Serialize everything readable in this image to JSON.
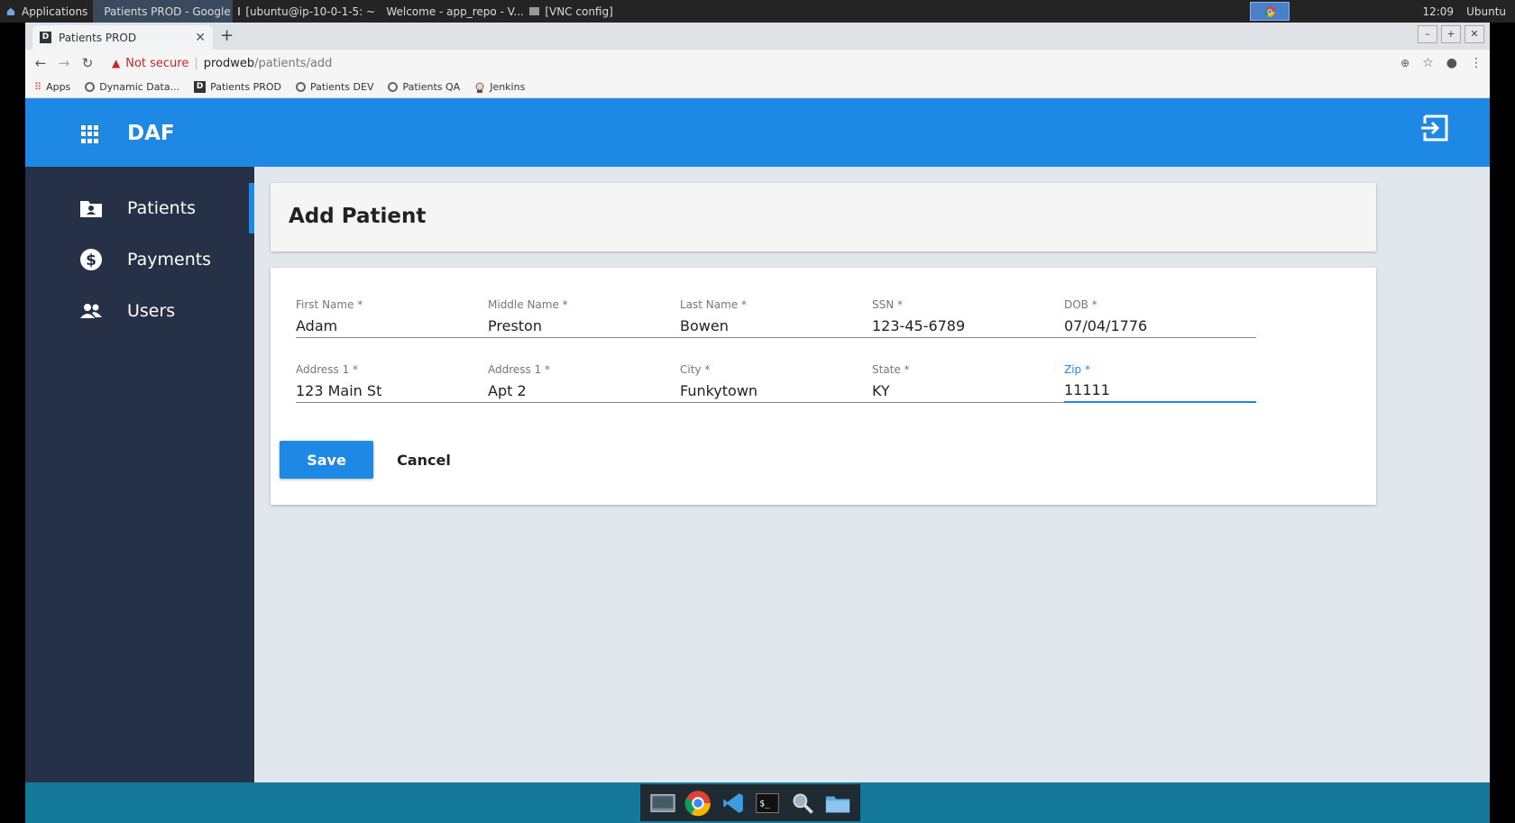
{
  "os_panel": {
    "apps_label": "Applications",
    "tasks": [
      {
        "label": "Patients PROD - Google ..."
      },
      {
        "label": "[ubuntu@ip-10-0-1-5: ~]"
      },
      {
        "label": "Welcome - app_repo - V..."
      },
      {
        "label": "[VNC config]"
      }
    ],
    "clock": "12:09",
    "user": "Ubuntu"
  },
  "browser": {
    "tab_title": "Patients PROD",
    "tab_favicon": "D",
    "security_label": "Not secure",
    "url_host": "prodweb",
    "url_path": "/patients/add",
    "bookmarks": [
      {
        "label": "Apps",
        "icon": "apps-grid-icon"
      },
      {
        "label": "Dynamic Data...",
        "icon": "globe-icon"
      },
      {
        "label": "Patients PROD",
        "icon": "d-favicon"
      },
      {
        "label": "Patients DEV",
        "icon": "globe-icon"
      },
      {
        "label": "Patients QA",
        "icon": "globe-icon"
      },
      {
        "label": "Jenkins",
        "icon": "jenkins-icon"
      }
    ]
  },
  "app": {
    "title": "DAF",
    "accent": "#1e88e5",
    "sidebar_bg": "#263046"
  },
  "sidebar": {
    "items": [
      {
        "label": "Patients",
        "icon": "patient-folder-icon",
        "active": true
      },
      {
        "label": "Payments",
        "icon": "dollar-circle-icon",
        "active": false
      },
      {
        "label": "Users",
        "icon": "users-icon",
        "active": false
      }
    ]
  },
  "page": {
    "title": "Add Patient"
  },
  "form": {
    "fields": [
      {
        "label": "First Name *",
        "value": "Adam"
      },
      {
        "label": "Middle Name *",
        "value": "Preston"
      },
      {
        "label": "Last Name *",
        "value": "Bowen"
      },
      {
        "label": "SSN *",
        "value": "123-45-6789"
      },
      {
        "label": "DOB *",
        "value": "07/04/1776"
      },
      {
        "label": "Address 1 *",
        "value": "123 Main St"
      },
      {
        "label": "Address 1 *",
        "value": "Apt 2"
      },
      {
        "label": "City *",
        "value": "Funkytown"
      },
      {
        "label": "State *",
        "value": "KY"
      },
      {
        "label": "Zip *",
        "value": "11111"
      }
    ],
    "save_label": "Save",
    "cancel_label": "Cancel"
  }
}
